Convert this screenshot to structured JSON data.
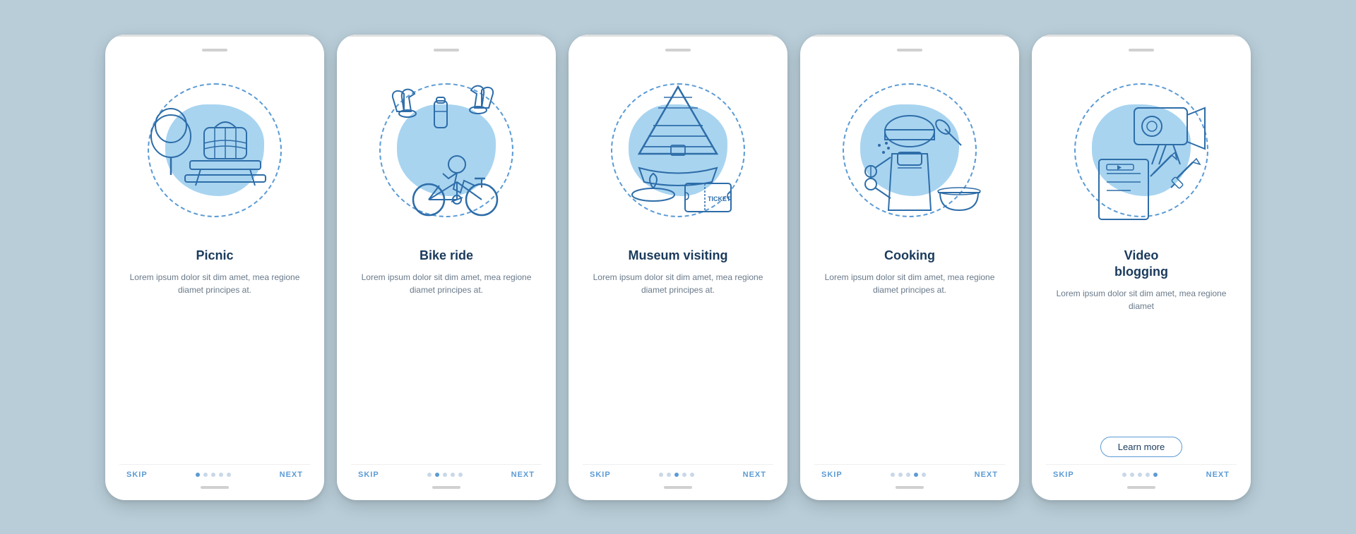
{
  "screens": [
    {
      "id": "picnic",
      "title": "Picnic",
      "description": "Lorem ipsum dolor sit dim amet, mea regione diamet principes at.",
      "active_dot": 0,
      "show_learn_more": false,
      "skip_label": "SKIP",
      "next_label": "NEXT"
    },
    {
      "id": "bike-ride",
      "title": "Bike ride",
      "description": "Lorem ipsum dolor sit dim amet, mea regione diamet principes at.",
      "active_dot": 1,
      "show_learn_more": false,
      "skip_label": "SKIP",
      "next_label": "NEXT"
    },
    {
      "id": "museum-visiting",
      "title": "Museum visiting",
      "description": "Lorem ipsum dolor sit dim amet, mea regione diamet principes at.",
      "active_dot": 2,
      "show_learn_more": false,
      "skip_label": "SKIP",
      "next_label": "NEXT"
    },
    {
      "id": "cooking",
      "title": "Cooking",
      "description": "Lorem ipsum dolor sit dim amet, mea regione diamet principes at.",
      "active_dot": 3,
      "show_learn_more": false,
      "skip_label": "SKIP",
      "next_label": "NEXT"
    },
    {
      "id": "video-blogging",
      "title": "Video\nblogging",
      "description": "Lorem ipsum dolor sit dim amet, mea regione diamet",
      "active_dot": 4,
      "show_learn_more": true,
      "learn_more_label": "Learn more",
      "skip_label": "SKIP",
      "next_label": "NEXT"
    }
  ],
  "dots_count": 5,
  "colors": {
    "accent": "#2e6da8",
    "light_blue": "#a8d4f0",
    "text_dark": "#1a3a5c",
    "text_gray": "#6a7a8a",
    "dot_inactive": "#c8d8e8",
    "dot_active": "#5b9bd5"
  }
}
